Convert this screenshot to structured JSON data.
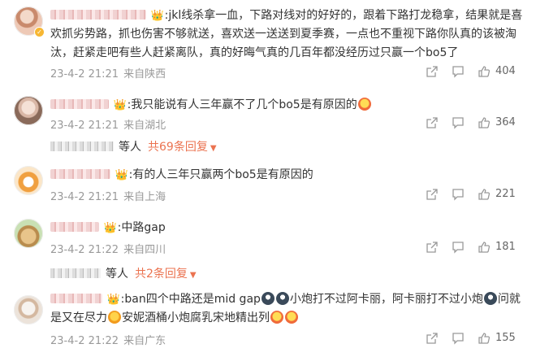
{
  "comments": [
    {
      "text": ":jkl线杀拿一血，下路对线对的好好的，跟着下路打龙稳拿，结果就是喜欢抓劣势路，抓也伤害不够就送，喜欢送一送送到夏季赛，一点也不重视下路你队真的该被淘汰，赶紧走吧有些人赶紧离队，真的好晦气真的几百年都没经历过只赢一个bo5了",
      "time": "23-4-2 21:21",
      "location": "来自陕西",
      "likes": "404"
    },
    {
      "text": ":我只能说有人三年赢不了几个bo5是有原因的",
      "time": "23-4-2 21:21",
      "location": "来自湖北",
      "likes": "364",
      "reply_suffix": "等人",
      "reply_more": "共69条回复"
    },
    {
      "text": ":有的人三年只赢两个bo5是有原因的",
      "time": "23-4-2 21:21",
      "location": "来自上海",
      "likes": "221"
    },
    {
      "text": ":中路gap",
      "time": "23-4-2 21:22",
      "location": "来自四川",
      "likes": "181",
      "reply_suffix": "等人",
      "reply_more": "共2条回复"
    },
    {
      "text_a": ":ban四个中路还是mid gap",
      "text_b": "小炮打不过阿卡丽，阿卡丽打不过小炮",
      "text_c": "问就是又在尽力",
      "text_d": "安妮酒桶小炮腐乳宋地精出列",
      "time": "23-4-2 21:22",
      "location": "来自广东",
      "likes": "155"
    }
  ],
  "colors": {
    "link": "#eb7350",
    "meta": "#999999",
    "badge": "#f7b733"
  },
  "icons": [
    "share-icon",
    "comment-icon",
    "like-icon",
    "crown-icon",
    "verified-icon",
    "caret-down-icon"
  ]
}
